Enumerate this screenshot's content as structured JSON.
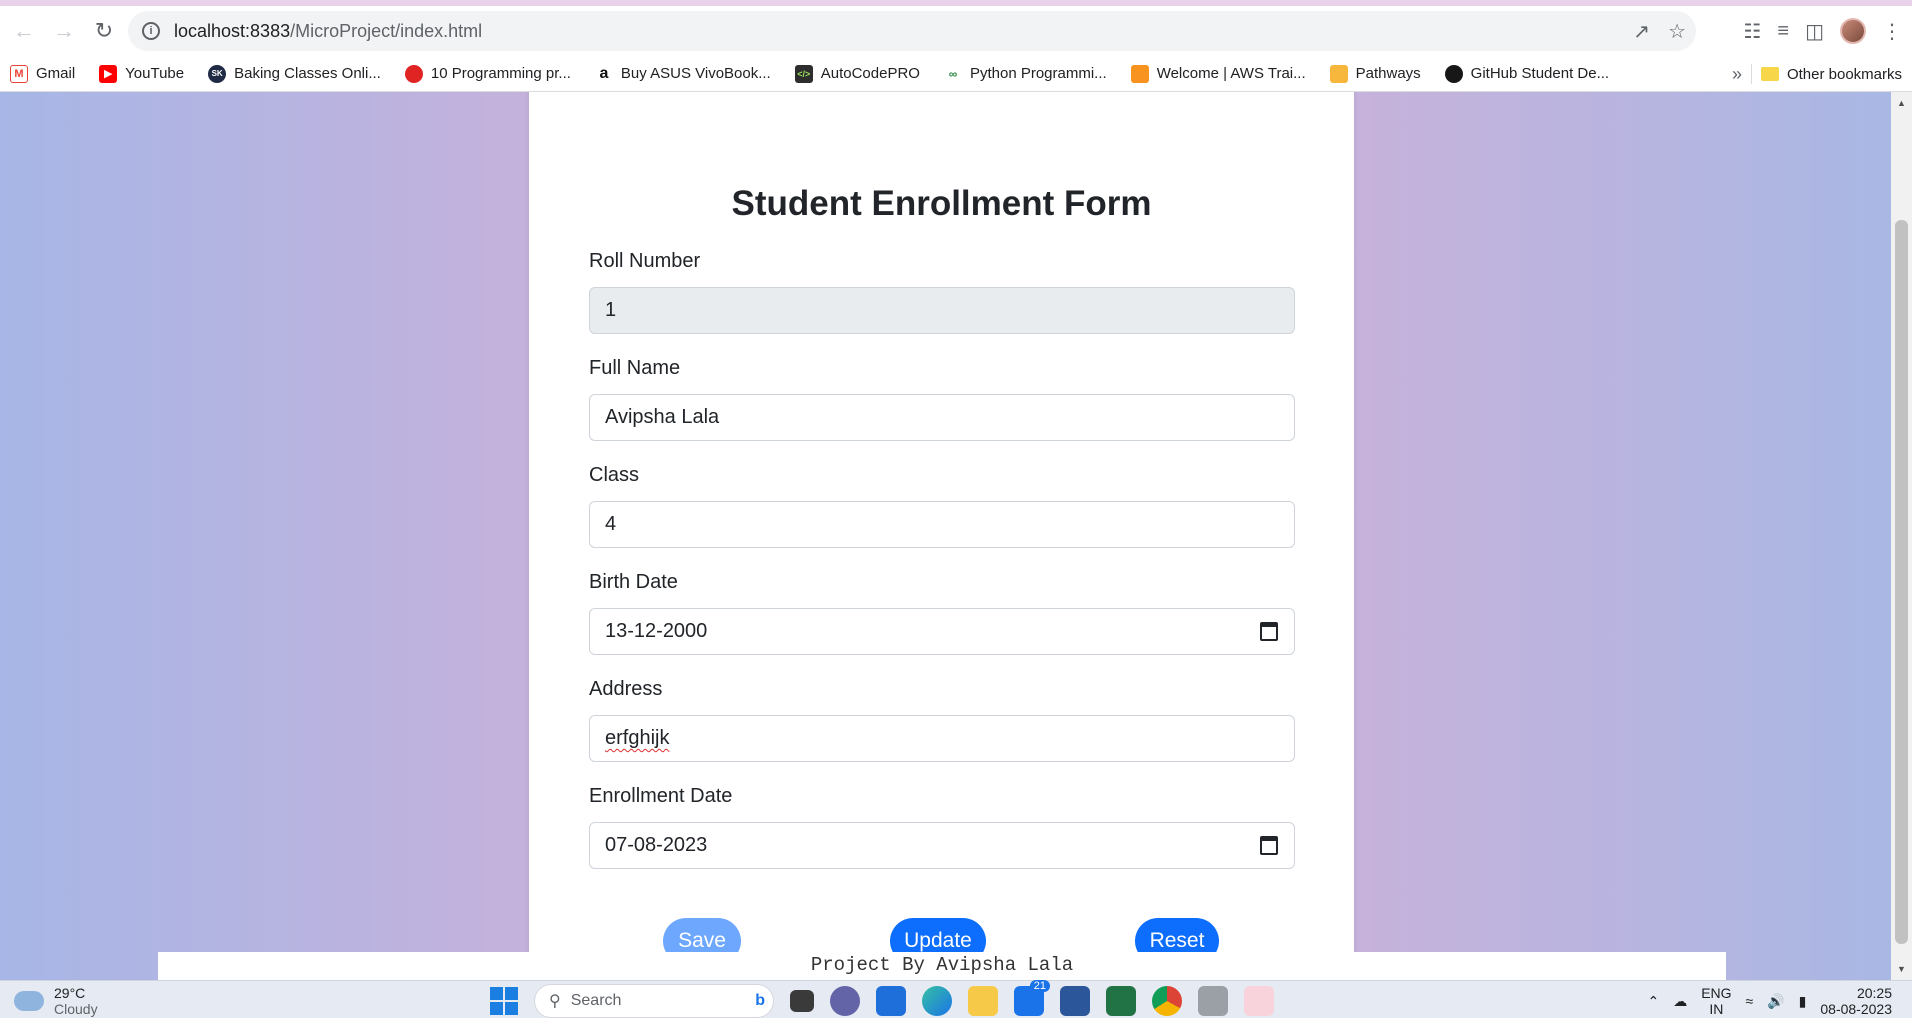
{
  "browser": {
    "url_host": "localhost:8383",
    "url_path": "/MicroProject/index.html",
    "bookmarks": [
      {
        "label": "Gmail",
        "icon": "gmail-icon",
        "color": "#ea4335"
      },
      {
        "label": "YouTube",
        "icon": "youtube-icon",
        "color": "#ff0000"
      },
      {
        "label": "Baking Classes Onli...",
        "icon": "sk-icon",
        "color": "#1f2a44"
      },
      {
        "label": "10 Programming pr...",
        "icon": "red-circle-icon",
        "color": "#e02424"
      },
      {
        "label": "Buy ASUS VivoBook...",
        "icon": "amazon-icon",
        "color": "#111111"
      },
      {
        "label": "AutoCodePRO",
        "icon": "code-icon",
        "color": "#2d2d2d"
      },
      {
        "label": "Python Programmi...",
        "icon": "geeks-icon",
        "color": "#2f8d46"
      },
      {
        "label": "Welcome | AWS Trai...",
        "icon": "aws-icon",
        "color": "#f7931e"
      },
      {
        "label": "Pathways",
        "icon": "box-icon",
        "color": "#f6b73c"
      },
      {
        "label": "GitHub Student De...",
        "icon": "github-icon",
        "color": "#181717"
      }
    ],
    "more_label": "»",
    "other_bookmarks": "Other bookmarks"
  },
  "form": {
    "title": "Student Enrollment Form",
    "fields": {
      "roll_number": {
        "label": "Roll Number",
        "value": "1"
      },
      "full_name": {
        "label": "Full Name",
        "value": "Avipsha Lala"
      },
      "class": {
        "label": "Class",
        "value": "4"
      },
      "birth_date": {
        "label": "Birth Date",
        "value": "13-12-2000"
      },
      "address": {
        "label": "Address",
        "value": "erfghijk"
      },
      "enrollment_date": {
        "label": "Enrollment Date",
        "value": "07-08-2023"
      }
    },
    "buttons": {
      "save": "Save",
      "update": "Update",
      "reset": "Reset"
    }
  },
  "footer": {
    "text": "Project By Avipsha Lala"
  },
  "taskbar": {
    "temperature": "29°C",
    "weather": "Cloudy",
    "search_placeholder": "Search",
    "mail_badge": "21",
    "language": "ENG",
    "language_region": "IN",
    "time": "20:25",
    "date": "08-08-2023"
  },
  "colors": {
    "primary": "#0d6efd",
    "primary_disabled": "#6ea8fe",
    "readonly_bg": "#e9ecef"
  }
}
